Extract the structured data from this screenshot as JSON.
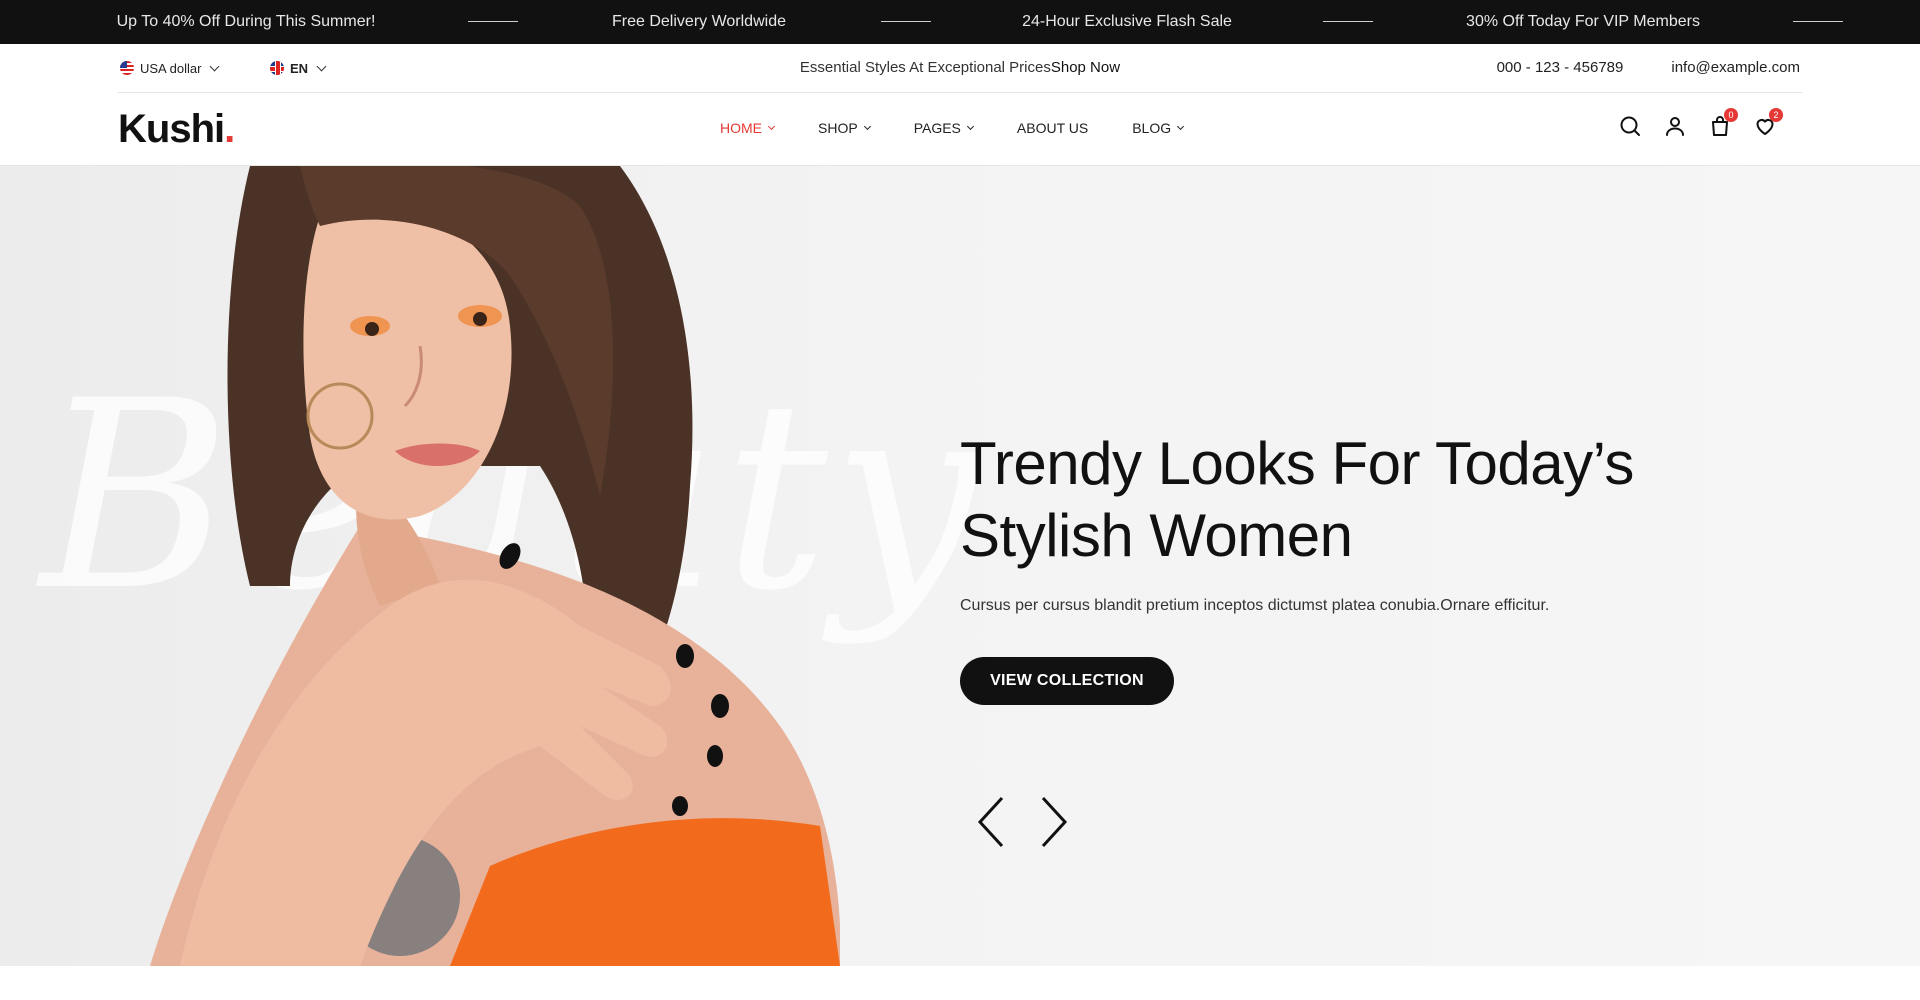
{
  "announcement": {
    "items": [
      "Up To 40% Off During This Summer!",
      "Free Delivery Worldwide",
      "24-Hour Exclusive Flash Sale",
      "30% Off Today For VIP Members"
    ]
  },
  "utility": {
    "currency": "USA dollar",
    "language": "EN",
    "promo_text": "Essential Styles At Exceptional Prices",
    "promo_link": "Shop Now",
    "phone": "000 - 123 - 456789",
    "email": "info@example.com"
  },
  "header": {
    "logo": "Kushi",
    "logo_dot": ".",
    "nav": [
      {
        "label": "Home",
        "active": true
      },
      {
        "label": "Shop"
      },
      {
        "label": "Pages"
      },
      {
        "label": "About Us"
      },
      {
        "label": "Blog"
      }
    ],
    "cart_count": "0",
    "wishlist_count": "2"
  },
  "hero": {
    "title_line1": "Trendy Looks For Today’s",
    "title_line2": "Stylish Women",
    "subtitle": "Cursus per cursus blandit pretium inceptos dictumst platea conubia.Ornare efficitur.",
    "button_label": "View Collection",
    "background_script": "Beauty"
  },
  "colors": {
    "accent": "#e53935",
    "dark": "#111111",
    "hero_bg": "#f3f3f3"
  }
}
